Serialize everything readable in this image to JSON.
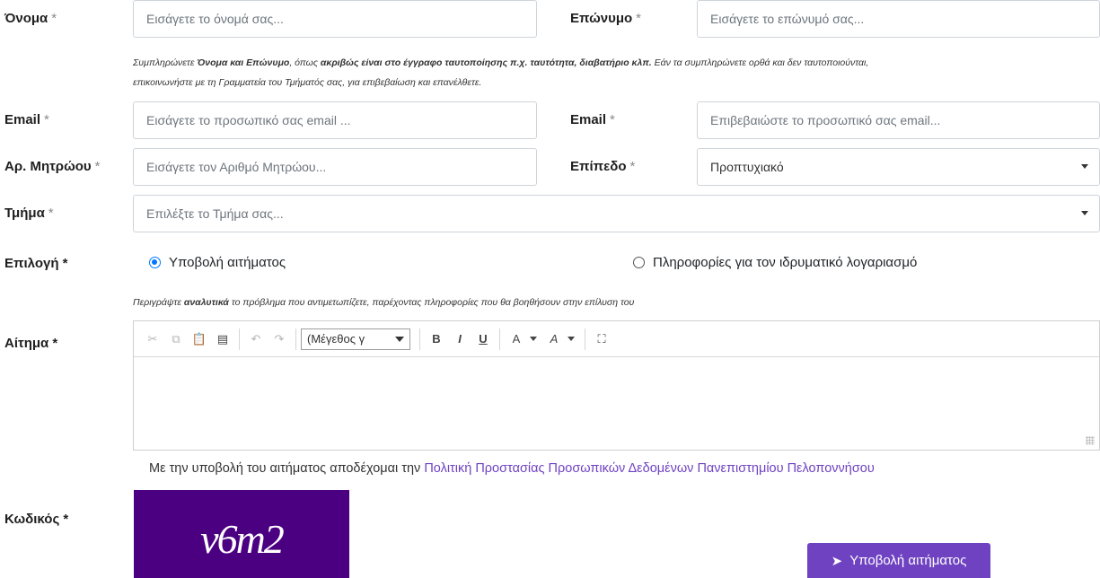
{
  "fields": {
    "first_name": {
      "label": "Όνομα",
      "req": "*",
      "placeholder": "Εισάγετε το όνομά σας..."
    },
    "last_name": {
      "label": "Επώνυμο",
      "req": "*",
      "placeholder": "Εισάγετε το επώνυμό σας..."
    },
    "email": {
      "label": "Email",
      "req": "*",
      "placeholder": "Εισάγετε το προσωπικό σας email ..."
    },
    "email_confirm": {
      "label": "Email",
      "req": "*",
      "placeholder": "Επιβεβαιώστε το προσωπικό σας email..."
    },
    "registry_no": {
      "label": "Αρ. Μητρώου",
      "req": "*",
      "placeholder": "Εισάγετε τον Αριθμό Μητρώου..."
    },
    "level": {
      "label": "Επίπεδο",
      "req": "*",
      "value": "Προπτυχιακό"
    },
    "department": {
      "label": "Τμήμα",
      "req": "*",
      "placeholder": "Επιλέξτε το Τμήμα σας..."
    },
    "choice": {
      "label": "Επιλογή *",
      "option1": "Υποβολή αιτήματος",
      "option2": "Πληροφορίες για τον ιδρυματικό λογαριασμό"
    },
    "request": {
      "label": "Αίτημα *"
    },
    "code": {
      "label": "Κωδικός *"
    }
  },
  "help_name": {
    "t1": "Συμπληρώνετε ",
    "b1": "Όνομα και Επώνυμο",
    "t2": ", όπως ",
    "b2": "ακριβώς είναι στο έγγραφο ταυτοποίησης π.χ. ταυτότητα, διαβατήριο κλπ.",
    "t3": " Εάν τα συμπληρώνετε ορθά και δεν ταυτοποιούνται,",
    "line2": "επικοινωνήστε με τη Γραμματεία του Τμήματός σας, για επιβεβαίωση και επανέλθετε."
  },
  "help_request": {
    "t1": "Περιγράψτε ",
    "b1": "αναλυτικά",
    "t2": " το πρόβλημα που αντιμετωπίζετε, παρέχοντας πληροφορίες που θα βοηθήσουν στην επίλυση του"
  },
  "editor": {
    "font_size_select": "(Μέγεθος γ",
    "bold": "B",
    "italic": "I",
    "underline": "U"
  },
  "consent": {
    "text": "Με την υποβολή του αιτήματος αποδέχομαι την ",
    "link": "Πολιτική Προστασίας Προσωπικών Δεδομένων Πανεπιστημίου Πελοποννήσου"
  },
  "captcha": {
    "text": "v6m2"
  },
  "submit_label": "Υποβολή αιτήματος",
  "colors": {
    "accent": "#6f42c1",
    "captcha_bg": "#4b0082",
    "radio_checked": "#0075ff"
  }
}
